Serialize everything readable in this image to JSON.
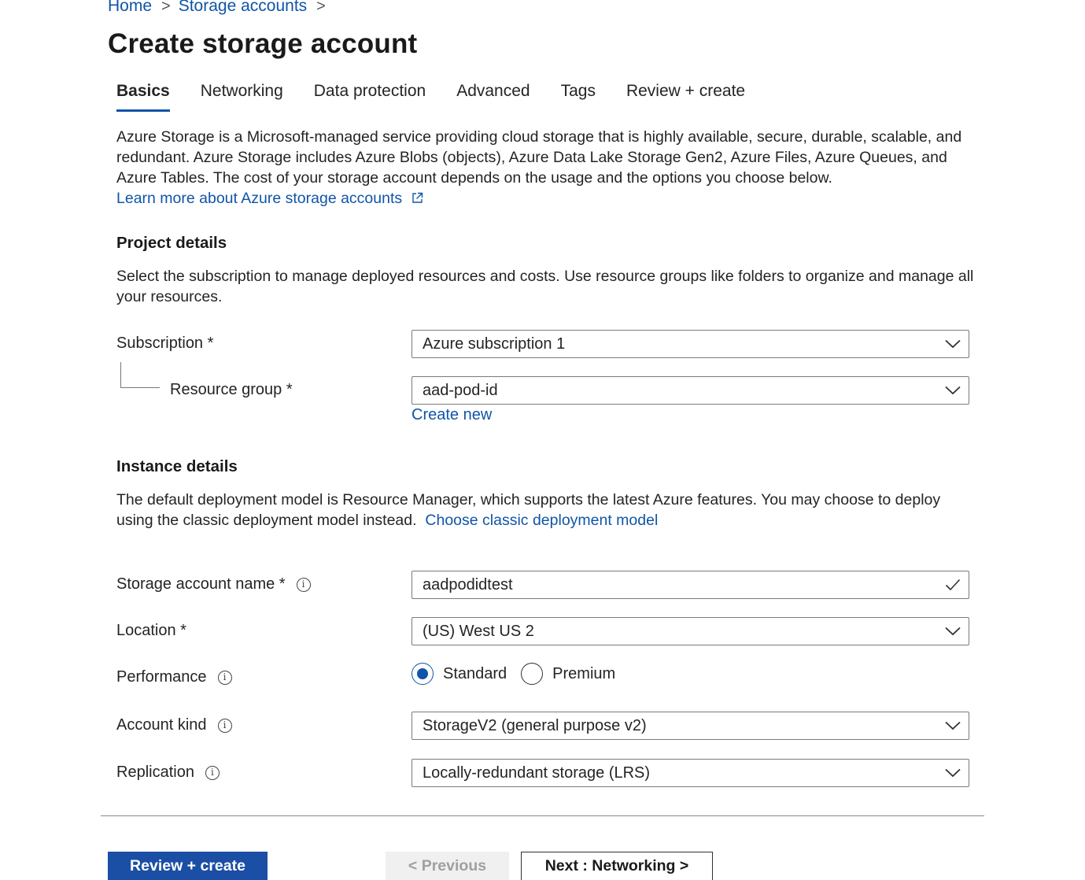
{
  "breadcrumb": {
    "home": "Home",
    "storage_accounts": "Storage accounts",
    "sep": ">"
  },
  "page_title": "Create storage account",
  "tabs": [
    {
      "label": "Basics",
      "active": true
    },
    {
      "label": "Networking"
    },
    {
      "label": "Data protection"
    },
    {
      "label": "Advanced"
    },
    {
      "label": "Tags"
    },
    {
      "label": "Review + create"
    }
  ],
  "intro": {
    "text": "Azure Storage is a Microsoft-managed service providing cloud storage that is highly available, secure, durable, scalable, and redundant. Azure Storage includes Azure Blobs (objects), Azure Data Lake Storage Gen2, Azure Files, Azure Queues, and Azure Tables. The cost of your storage account depends on the usage and the options you choose below.",
    "learn_more": "Learn more about Azure storage accounts"
  },
  "project_details": {
    "heading": "Project details",
    "description": "Select the subscription to manage deployed resources and costs. Use resource groups like folders to organize and manage all your resources.",
    "subscription_label": "Subscription *",
    "subscription_value": "Azure subscription 1",
    "resource_group_label": "Resource group *",
    "resource_group_value": "aad-pod-id",
    "create_new": "Create new"
  },
  "instance_details": {
    "heading": "Instance details",
    "description": "The default deployment model is Resource Manager, which supports the latest Azure features. You may choose to deploy using the classic deployment model instead.",
    "classic_link": "Choose classic deployment model",
    "storage_name_label": "Storage account name *",
    "storage_name_value": "aadpodidtest",
    "location_label": "Location *",
    "location_value": "(US) West US 2",
    "performance_label": "Performance",
    "performance_options": [
      "Standard",
      "Premium"
    ],
    "performance_selected": "Standard",
    "account_kind_label": "Account kind",
    "account_kind_value": "StorageV2 (general purpose v2)",
    "replication_label": "Replication",
    "replication_value": "Locally-redundant storage (LRS)"
  },
  "footer": {
    "review_create": "Review + create",
    "previous": "< Previous",
    "next": "Next : Networking >"
  },
  "icons": {
    "info": "i",
    "chevron": "chevron-down-icon",
    "check": "checkmark-icon",
    "external": "external-link-icon"
  },
  "colors": {
    "accent": "#0f55a8",
    "primary_button": "#1b4fa5"
  }
}
